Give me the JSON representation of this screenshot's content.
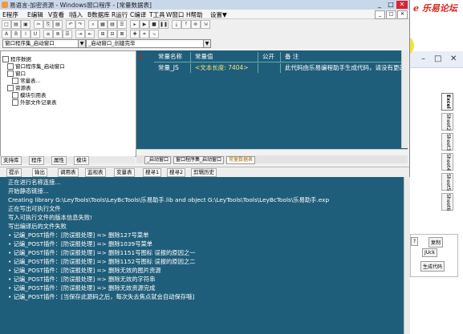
{
  "bg_app": {
    "logo": "e 乐易论坛",
    "bar_min": "–",
    "bar_max": "□",
    "bar_close": "✕",
    "side_tabs": [
      "Excel",
      "Sheet2",
      "Sheet3",
      "Sheet4",
      "Sheet5",
      "Sheet6"
    ],
    "buttons": [
      "复制",
      "JUck",
      "生成代码",
      "?"
    ]
  },
  "window": {
    "title": "易语言-加密资源 - Windows窗口程序 - [常量数据表]",
    "min": "_",
    "max": "□",
    "close": "✕"
  },
  "menu": {
    "items": [
      "E程序",
      "E编辑",
      "V查看",
      "I插入",
      "B数据库",
      "R运行",
      "C编译",
      "T工具",
      "W窗口",
      "H帮助",
      "设置▼"
    ],
    "right_buttons": [
      "_",
      "□",
      "✕"
    ]
  },
  "toolbar1": [
    "□",
    "▤",
    "▣",
    "✂",
    "⎘",
    "▤",
    "↶",
    "↷",
    "⌕",
    "▦",
    "▤",
    "☰",
    "▸",
    "▶",
    "■",
    "❚❚",
    "⤓",
    "⤒",
    "⎆",
    "⇲"
  ],
  "toolbar2": [
    "A",
    "B",
    "I",
    "U",
    "≡",
    "≣",
    "☰",
    "⇥",
    "⇤",
    "⊞",
    "⊟",
    "⊠",
    "✚",
    "⌗",
    "⤷"
  ],
  "combos": {
    "left": "窗口程序集_启动窗口",
    "right": "_启动窗口_创建完毕"
  },
  "tree": {
    "items": [
      "程序数据",
      "窗口程序集_启动窗口",
      "窗口",
      "常量表...",
      "资源表",
      "模块引用表",
      "外部文件记录表"
    ]
  },
  "left_tabs": [
    "支持库",
    "程序",
    "属性",
    "模块"
  ],
  "editor": {
    "headers": [
      "常量名称",
      "常量值",
      "公开",
      "备 注"
    ],
    "row": {
      "name": "常量_JS",
      "value": "<文本长度: 7404>",
      "public": "",
      "note": "此代码由乐易编程助手生成代码，请没有更改代码"
    },
    "tabs": [
      "_启动窗口",
      "窗口程序集_启动窗口",
      "常量数据表"
    ]
  },
  "output_tabs": [
    "提示",
    "输出",
    "调用表",
    "监视表",
    "变量表",
    "搜寻1",
    "搜寻2",
    "剪辑历史"
  ],
  "output_lines": [
    "正在进行名称连接...",
    "开始静态链接...",
    "    Creating library G:\\LeyTools\\Tools\\LeyBcTools\\乐易助手.lib and object G:\\LeyTools\\Tools\\LeyBcTools\\乐易助手.exp",
    "正在写出可执行文件",
    "写入可执行文件的版本信息失败!",
    "写出编译后的文件失败",
    "• 记编_POST插件：[防误报处理] => 删除127号菜单",
    "• 记编_POST插件：[防误报处理] => 删除1039号菜单",
    "• 记编_POST插件：[防误报处理] => 删除1151号图标  误报的原因之一",
    "• 记编_POST插件：[防误报处理] => 删除1152号图标  误报的原因之二",
    "• 记编_POST插件：[防误报处理] => 删除无效的图片资源",
    "• 记编_POST插件：[防误报处理] => 删除无效的字符串",
    "• 记编_POST插件：[防误报处理] => 删除无效资源完成",
    "• 记编_POST插件：[当保存此源码之后，每次失去焦点就会自动保存哦]"
  ],
  "colors": {
    "editor_bg": "#1f5e7a",
    "header_text": "#ffffff",
    "value_text": "#f6e27a",
    "note_text": "#ffffff"
  }
}
